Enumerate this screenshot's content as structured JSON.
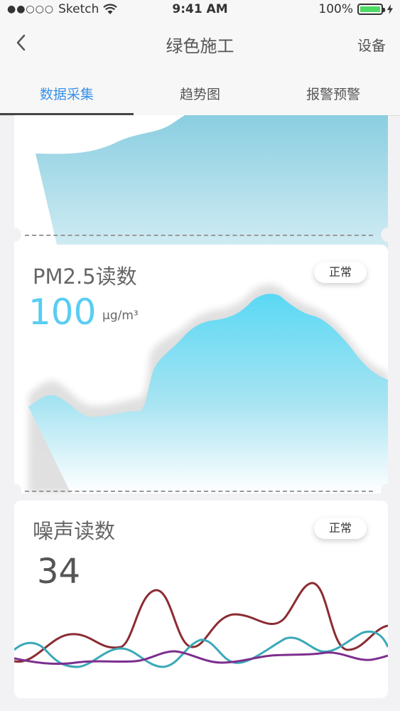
{
  "status_bar": {
    "signal_dots": "●●○○○",
    "carrier": "Sketch",
    "time": "9:41 AM",
    "battery": "100%"
  },
  "nav": {
    "title": "绿色施工",
    "right_label": "设备"
  },
  "tabs": [
    {
      "label": "数据采集",
      "active": true
    },
    {
      "label": "趋势图",
      "active": false
    },
    {
      "label": "报警预警",
      "active": false
    }
  ],
  "pm25": {
    "title": "PM2.5读数",
    "status": "正常",
    "value": "100",
    "unit": "μg/m³"
  },
  "noise": {
    "title": "噪声读数",
    "status": "正常",
    "value": "34"
  },
  "colors": {
    "tab_active": "#3a91e8",
    "value_blue": "#59cdf3",
    "line_maroon": "#8b2c33",
    "line_teal": "#3aa8b8",
    "line_purple": "#7d2e8e"
  }
}
